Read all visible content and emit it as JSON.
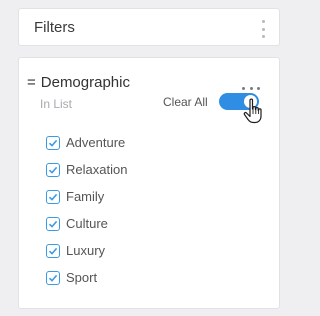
{
  "filters_panel": {
    "title": "Filters",
    "menu_icon": "vertical-ellipsis-icon"
  },
  "filter": {
    "name": "Demographic",
    "drag_icon": "equals-icon",
    "subtitle": "In List",
    "menu_icon": "horizontal-ellipsis-icon",
    "clear_all_label": "Clear All",
    "toggle_on": true,
    "options": [
      {
        "label": "Adventure",
        "checked": true
      },
      {
        "label": "Relaxation",
        "checked": true
      },
      {
        "label": "Family",
        "checked": true
      },
      {
        "label": "Culture",
        "checked": true
      },
      {
        "label": "Luxury",
        "checked": true
      },
      {
        "label": "Sport",
        "checked": true
      }
    ]
  },
  "colors": {
    "accent": "#2f8de4",
    "checkbox": "#3b9ae6",
    "background": "#efeff1"
  }
}
